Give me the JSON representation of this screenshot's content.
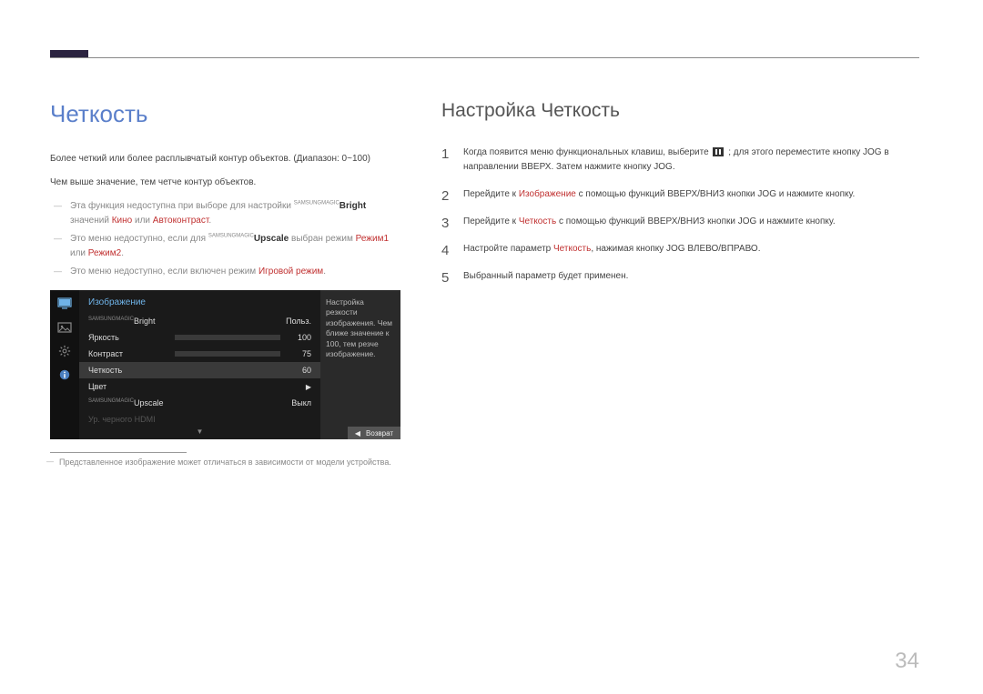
{
  "left": {
    "title": "Четкость",
    "p1": "Более четкий или более расплывчатый контур объектов. (Диапазон: 0~100)",
    "p2": "Чем выше значение, тем четче контур объектов.",
    "note1a": "Эта функция недоступна при выборе для настройки ",
    "note1_sup": "SAMSUNG",
    "note1_brand": "MAGIC",
    "note1_bold": "Bright",
    "note1b": " значений ",
    "note1_kw1": "Кино",
    "note1_or": " или ",
    "note1_kw2": "Автоконтраст",
    "note2a": "Это меню недоступно, если для ",
    "note2_bold": "Upscale",
    "note2b": " выбран режим ",
    "note2_kw1": "Режим1",
    "note2_kw2": "Режим2",
    "note3a": "Это меню недоступно, если включен режим ",
    "note3_kw": "Игровой режим",
    "caption": "Представленное изображение может отличаться в зависимости от модели устройства."
  },
  "osd": {
    "header": "Изображение",
    "rows": {
      "bright_label": "Bright",
      "bright_val": "Польз.",
      "brightness_label": "Яркость",
      "brightness_val": "100",
      "contrast_label": "Контраст",
      "contrast_val": "75",
      "sharpness_label": "Четкость",
      "sharpness_val": "60",
      "color_label": "Цвет",
      "upscale_label": "Upscale",
      "upscale_val": "Выкл",
      "hdmi_label": "Ур. черного HDMI"
    },
    "desc": "Настройка резкости изображения. Чем ближе значение к 100, тем резче изображение.",
    "footer_back": "Возврат"
  },
  "right": {
    "title": "Настройка Четкость",
    "step1a": "Когда появится меню функциональных клавиш, выберите ",
    "step1b": " ; для этого переместите кнопку JOG в направлении ВВЕРХ. Затем нажмите кнопку JOG.",
    "step2a": "Перейдите к ",
    "step2_kw": "Изображение",
    "step2b": " с помощью функций ВВЕРХ/ВНИЗ кнопки JOG и нажмите кнопку.",
    "step3a": "Перейдите к ",
    "step3_kw": "Четкость",
    "step3b": " с помощью функций ВВЕРХ/ВНИЗ кнопки JOG и нажмите кнопку.",
    "step4a": "Настройте параметр ",
    "step4_kw": "Четкость",
    "step4b": ", нажимая кнопку JOG ВЛЕВО/ВПРАВО.",
    "step5": "Выбранный параметр будет применен."
  },
  "page": "34"
}
